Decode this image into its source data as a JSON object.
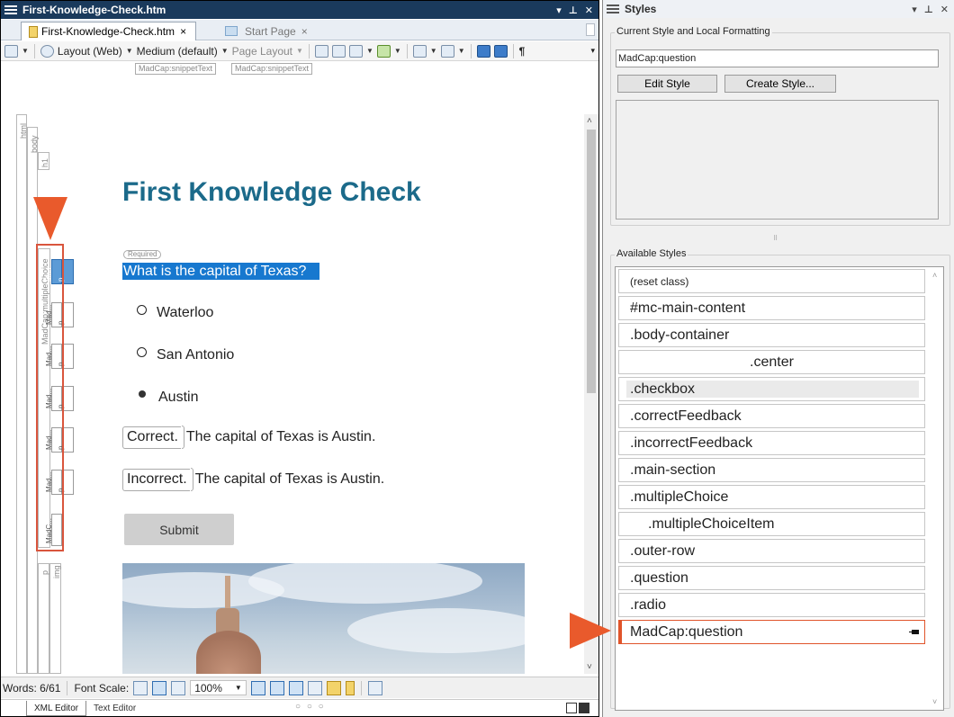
{
  "editor": {
    "title": "First-Knowledge-Check.htm",
    "tabs": [
      {
        "label": "First-Knowledge-Check.htm",
        "close": "×"
      },
      {
        "label": "Start Page",
        "close": "×"
      }
    ],
    "toolbar": {
      "layout": "Layout (Web)",
      "medium": "Medium (default)",
      "page_layout": "Page Layout",
      "pilcrow": "¶"
    },
    "snippet_tags": [
      "MadCap:snippetText",
      "MadCap:snippetText"
    ],
    "structure": {
      "html": "html",
      "body": "body",
      "h1": "h1",
      "multiple_choice": "MadCap:multipleChoice",
      "mad_boxes": [
        "Mad...",
        "Mad...",
        "Mad...",
        "Mad...",
        "Mad...",
        "Mad...",
        "MadC..."
      ],
      "p_boxes": [
        "p",
        "p",
        "p",
        "p",
        "p",
        "p"
      ],
      "p_last": "p",
      "img": "img"
    },
    "content": {
      "heading": "First Knowledge Check",
      "required_tag": "Required",
      "question": "What is the capital of Texas?",
      "choices": [
        "Waterloo",
        "San Antonio",
        "Austin"
      ],
      "selected_choice_index": 2,
      "feedback": [
        {
          "tag": "Correct.",
          "text": "The capital of Texas is Austin."
        },
        {
          "tag": "Incorrect.",
          "text": "The capital of Texas is Austin."
        }
      ],
      "submit_label": "Submit"
    },
    "status": {
      "words": "Words: 6/61",
      "font_scale": "Font Scale:",
      "zoom": "100%"
    },
    "bottom_tabs": [
      "XML Editor",
      "Text Editor"
    ],
    "dots": "○ ○ ○"
  },
  "styles": {
    "title": "Styles",
    "current_group": "Current Style and Local Formatting",
    "current_style": "MadCap:question",
    "edit_style": "Edit Style",
    "create_style": "Create Style...",
    "available_group": "Available Styles",
    "splitter": "⠿",
    "items": [
      {
        "label": "(reset class)"
      },
      {
        "label": "#mc-main-content"
      },
      {
        "label": ".body-container"
      },
      {
        "label": ".center"
      },
      {
        "label": ".checkbox"
      },
      {
        "label": ".correctFeedback"
      },
      {
        "label": ".incorrectFeedback"
      },
      {
        "label": ".main-section"
      },
      {
        "label": ".multipleChoice"
      },
      {
        "label": ".multipleChoiceItem"
      },
      {
        "label": ".outer-row"
      },
      {
        "label": ".question"
      },
      {
        "label": ".radio"
      },
      {
        "label": "MadCap:question"
      }
    ],
    "selected_index": 13
  },
  "colors": {
    "callout": "#e95a2c",
    "heading": "#1b6a8a",
    "selection": "#1778cf",
    "title_bar": "#1a3a5c"
  }
}
